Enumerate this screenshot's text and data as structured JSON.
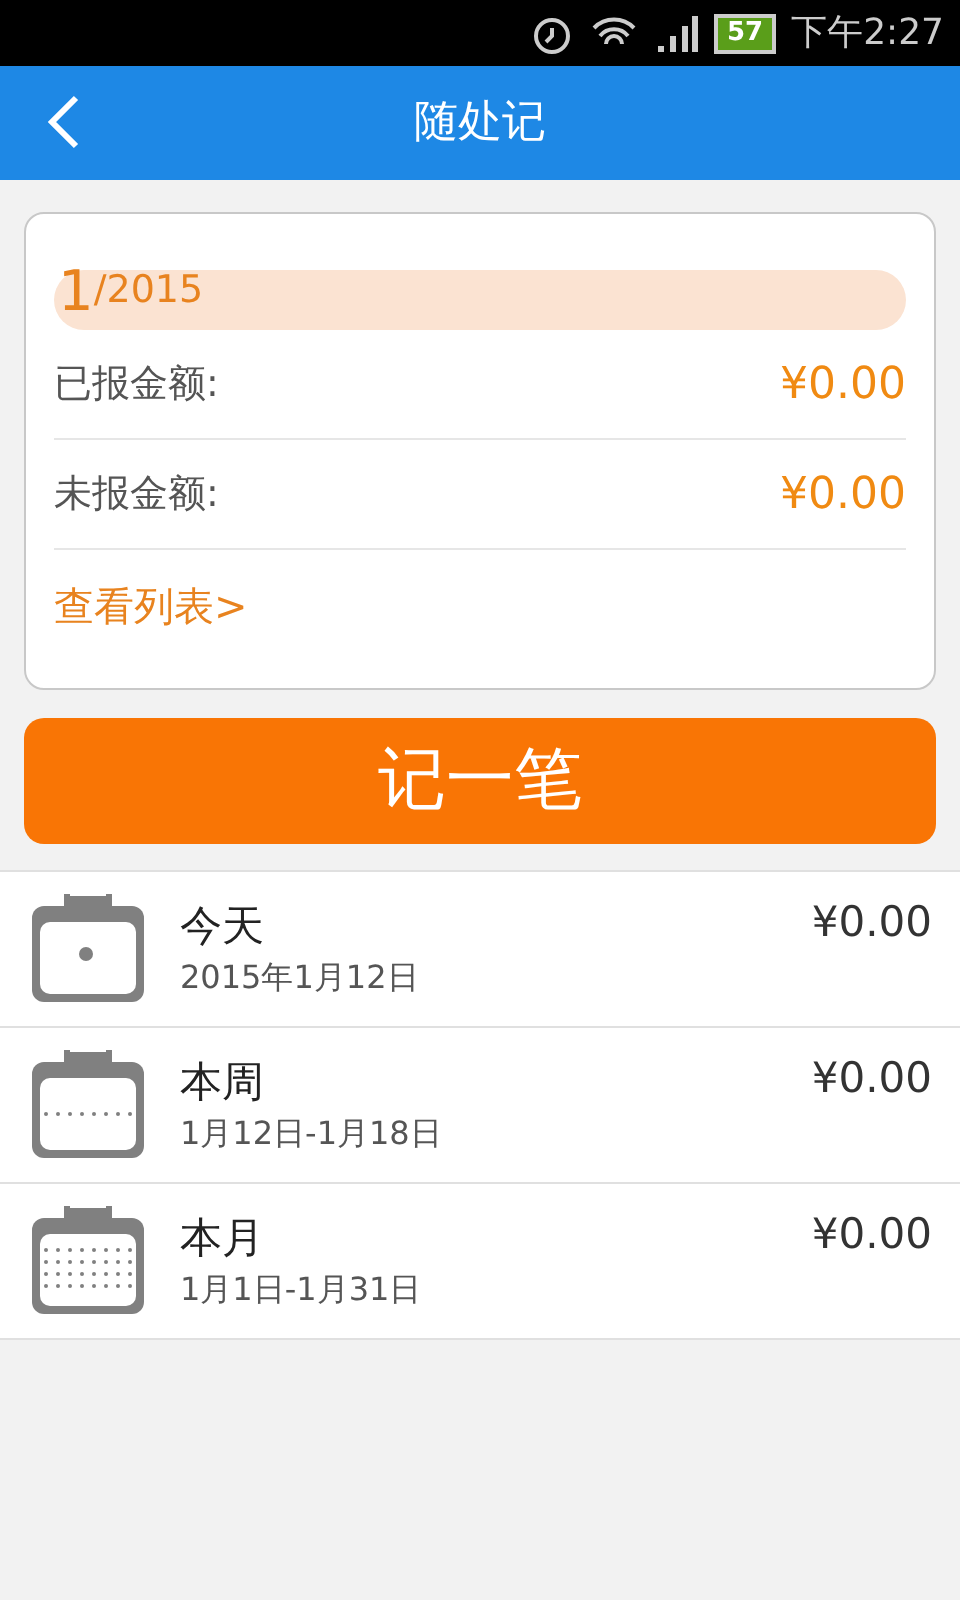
{
  "status_bar": {
    "battery": "57",
    "time": "下午2:27"
  },
  "app_bar": {
    "title": "随处记"
  },
  "summary": {
    "month": "1",
    "year": "/2015",
    "rows": [
      {
        "label": "已报金额:",
        "amount": "¥0.00"
      },
      {
        "label": "未报金额:",
        "amount": "¥0.00"
      }
    ],
    "link": "查看列表>"
  },
  "record_button": "记一笔",
  "periods": [
    {
      "kind": "day",
      "title": "今天",
      "range": "2015年1月12日",
      "amount": "¥0.00"
    },
    {
      "kind": "week",
      "title": "本周",
      "range": "1月12日-1月18日",
      "amount": "¥0.00"
    },
    {
      "kind": "month",
      "title": "本月",
      "range": "1月1日-1月31日",
      "amount": "¥0.00"
    }
  ]
}
